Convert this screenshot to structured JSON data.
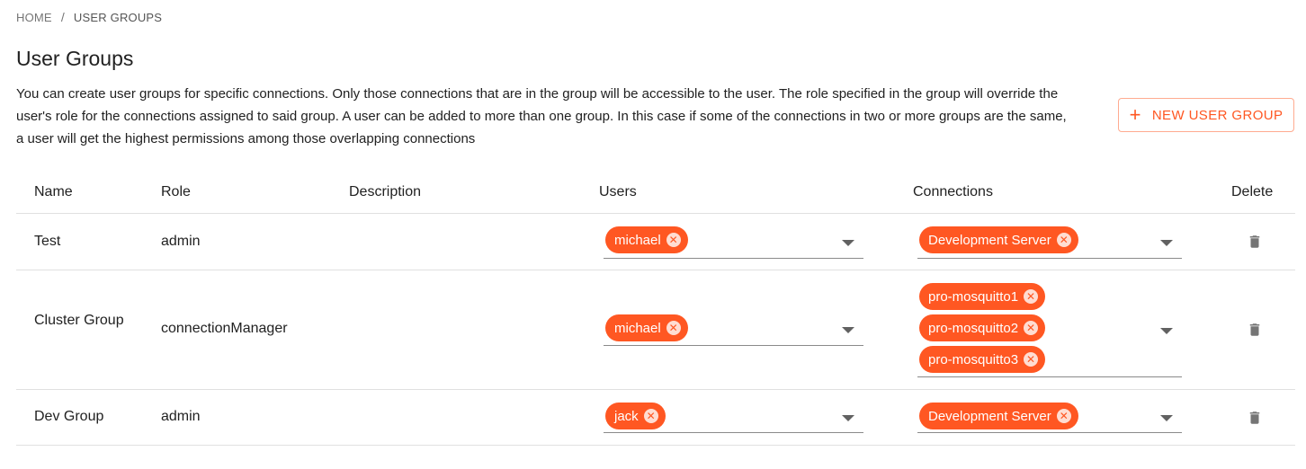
{
  "breadcrumb": {
    "home": "HOME",
    "separator": "/",
    "current": "USER GROUPS"
  },
  "page": {
    "title": "User Groups",
    "description": "You can create user groups for specific connections. Only those connections that are in the group will be accessible to the user. The role specified in the group will override the user's role for the connections assigned to said group. A user can be added to more than one group. In this case if some of the connections in two or more groups are the same, a user will get the highest permissions among those overlapping connections"
  },
  "actions": {
    "new_group_label": "NEW USER GROUP",
    "plus_icon": "+"
  },
  "table": {
    "columns": {
      "name": "Name",
      "role": "Role",
      "description": "Description",
      "users": "Users",
      "connections": "Connections",
      "delete": "Delete"
    },
    "rows": [
      {
        "name": "Test",
        "role": "admin",
        "description": "",
        "users": [
          "michael"
        ],
        "connections": [
          "Development Server"
        ]
      },
      {
        "name": "Cluster Group",
        "role": "connectionManager",
        "description": "",
        "users": [
          "michael"
        ],
        "connections": [
          "pro-mosquitto1",
          "pro-mosquitto2",
          "pro-mosquitto3"
        ]
      },
      {
        "name": "Dev Group",
        "role": "admin",
        "description": "",
        "users": [
          "jack"
        ],
        "connections": [
          "Development Server"
        ]
      }
    ]
  },
  "icons": {
    "chip_remove": "close-circle-icon",
    "dropdown": "arrow-drop-down-icon",
    "delete": "trash-icon"
  },
  "colors": {
    "accent": "#ff5722",
    "text": "#212121",
    "icon_grey": "#757575"
  }
}
